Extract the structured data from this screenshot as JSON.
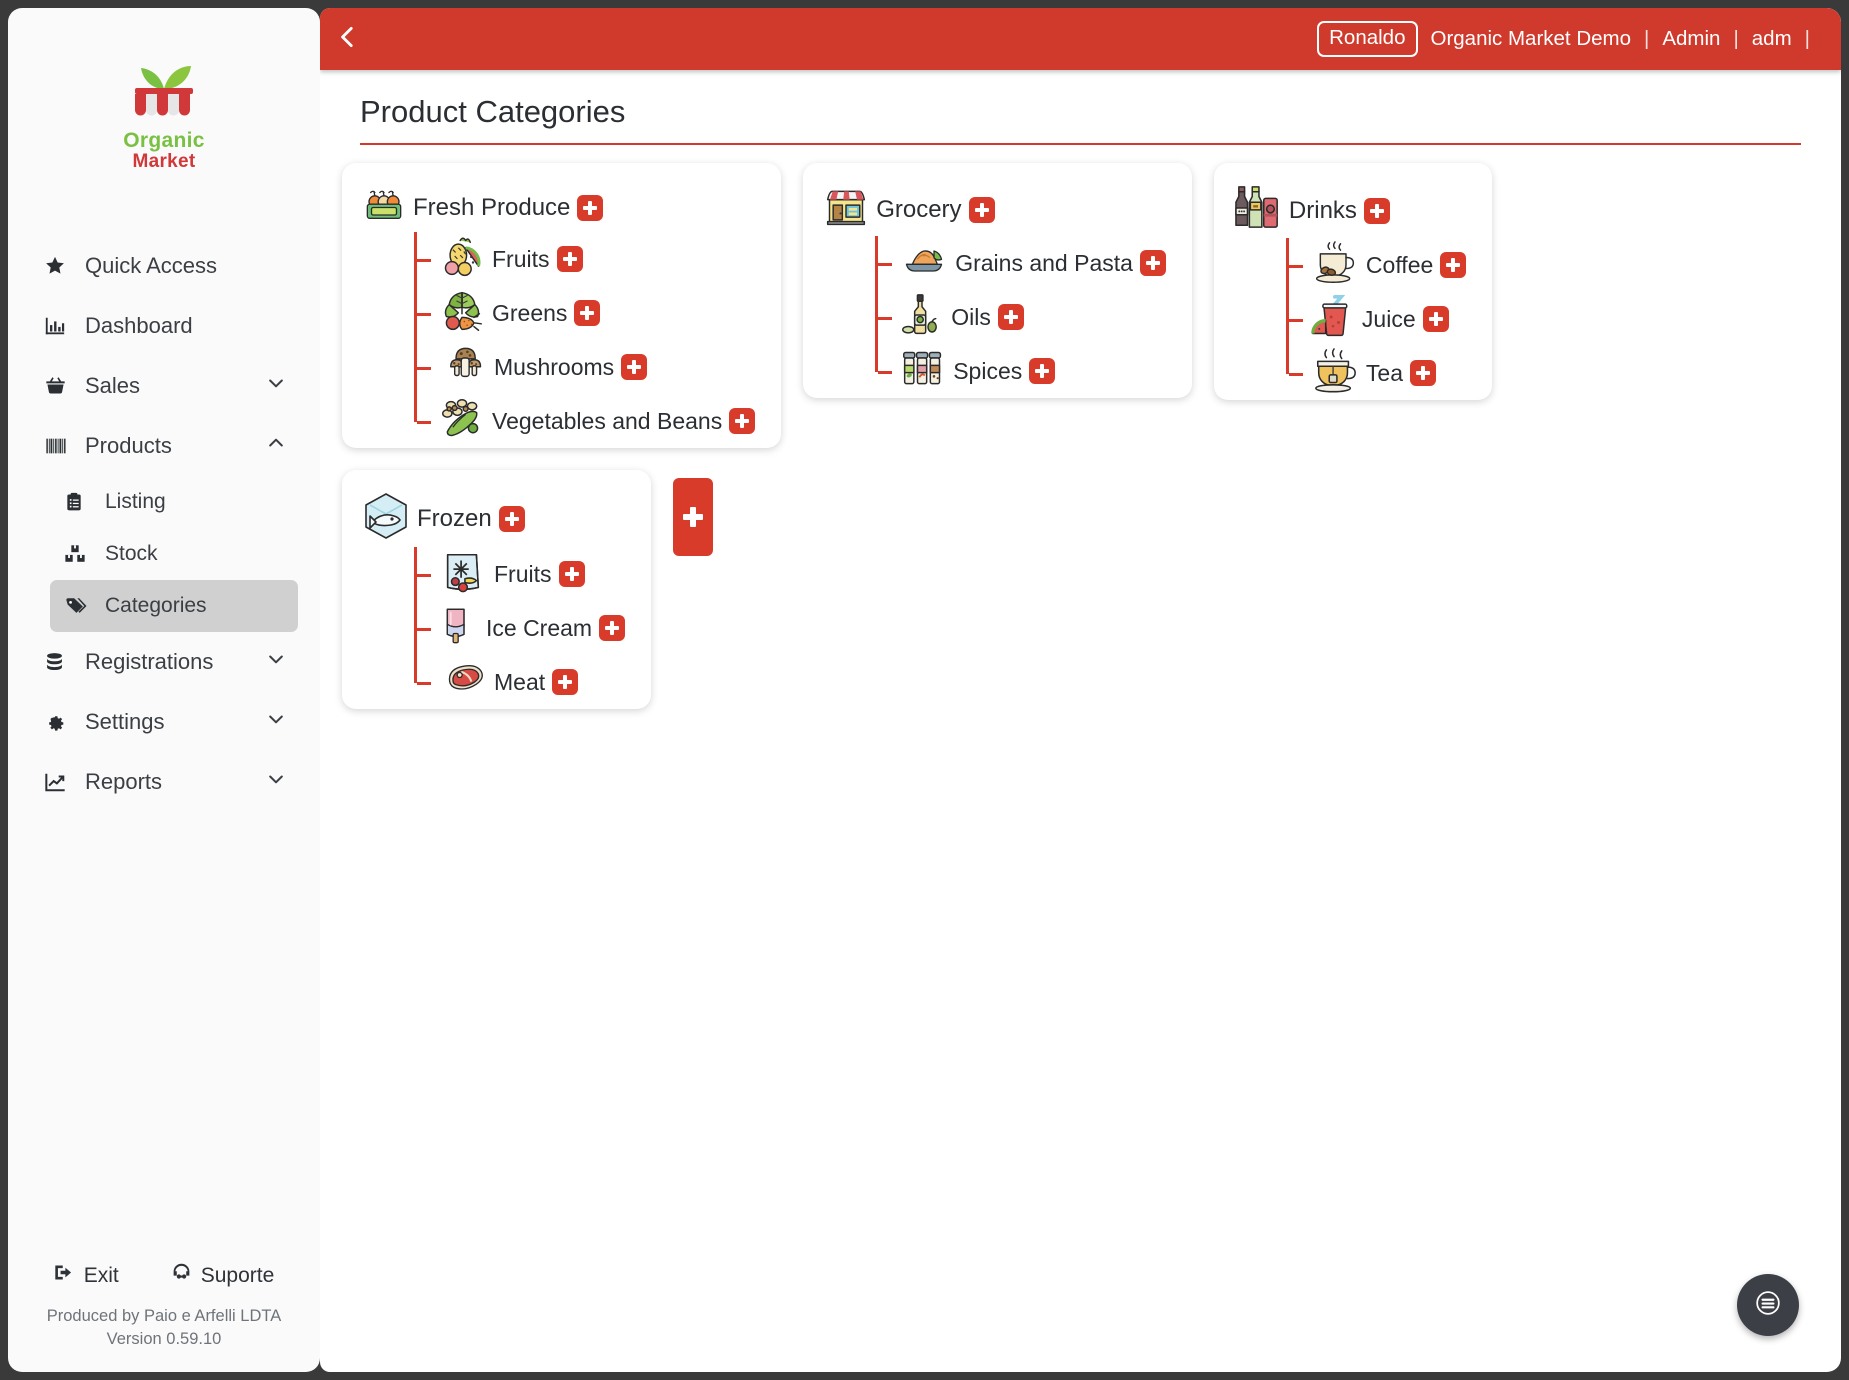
{
  "app": {
    "logo_top": "Organic",
    "logo_bottom": "Market"
  },
  "topbar": {
    "back_icon": "chevron-left-icon",
    "user": "Ronaldo",
    "company": "Organic Market Demo",
    "role": "Admin",
    "account": "adm",
    "separator": "|",
    "background_color": "#cf3a2c"
  },
  "sidebar": {
    "items": [
      {
        "label": "Quick Access",
        "icon": "star-icon",
        "expandable": false,
        "active": false,
        "sub": false
      },
      {
        "label": "Dashboard",
        "icon": "bar-chart-icon",
        "expandable": false,
        "active": false,
        "sub": false
      },
      {
        "label": "Sales",
        "icon": "basket-icon",
        "expandable": true,
        "expanded": false,
        "active": false,
        "sub": false
      },
      {
        "label": "Products",
        "icon": "barcode-icon",
        "expandable": true,
        "expanded": true,
        "active": false,
        "sub": false
      },
      {
        "label": "Listing",
        "icon": "clipboard-list-icon",
        "expandable": false,
        "active": false,
        "sub": true
      },
      {
        "label": "Stock",
        "icon": "boxes-icon",
        "expandable": false,
        "active": false,
        "sub": true
      },
      {
        "label": "Categories",
        "icon": "tags-icon",
        "expandable": false,
        "active": true,
        "sub": true
      },
      {
        "label": "Registrations",
        "icon": "database-icon",
        "expandable": true,
        "expanded": false,
        "active": false,
        "sub": false
      },
      {
        "label": "Settings",
        "icon": "gear-icon",
        "expandable": true,
        "expanded": false,
        "active": false,
        "sub": false
      },
      {
        "label": "Reports",
        "icon": "line-chart-icon",
        "expandable": true,
        "expanded": false,
        "active": false,
        "sub": false
      }
    ],
    "exit_label": "Exit",
    "exit_icon": "sign-out-icon",
    "support_label": "Suporte",
    "support_icon": "headset-icon",
    "credit_line1": "Produced by Paio e Arfelli LDTA",
    "credit_line2": "Version 0.59.10"
  },
  "page": {
    "title": "Product Categories",
    "accent_color": "#cf3a2c",
    "add_button_icon": "plus-icon",
    "add_card_button_label": "+",
    "fab_icon": "menu-icon"
  },
  "categories": [
    {
      "name": "Fresh Produce",
      "icon": "produce-crate-icon",
      "children": [
        {
          "name": "Fruits",
          "icon": "fruits-icon"
        },
        {
          "name": "Greens",
          "icon": "leafy-greens-icon"
        },
        {
          "name": "Mushrooms",
          "icon": "mushrooms-icon"
        },
        {
          "name": "Vegetables and Beans",
          "icon": "beans-icon"
        }
      ]
    },
    {
      "name": "Grocery",
      "icon": "storefront-icon",
      "children": [
        {
          "name": "Grains and Pasta",
          "icon": "paella-icon"
        },
        {
          "name": "Oils",
          "icon": "oil-bottle-icon"
        },
        {
          "name": "Spices",
          "icon": "spice-jars-icon"
        }
      ]
    },
    {
      "name": "Drinks",
      "icon": "bottles-icon",
      "children": [
        {
          "name": "Coffee",
          "icon": "coffee-cup-icon"
        },
        {
          "name": "Juice",
          "icon": "juice-glass-icon"
        },
        {
          "name": "Tea",
          "icon": "tea-cup-icon"
        }
      ]
    },
    {
      "name": "Frozen",
      "icon": "ice-cube-fish-icon",
      "children": [
        {
          "name": "Fruits",
          "icon": "frozen-bag-icon"
        },
        {
          "name": "Ice Cream",
          "icon": "popsicle-icon"
        },
        {
          "name": "Meat",
          "icon": "steak-icon"
        }
      ]
    }
  ]
}
